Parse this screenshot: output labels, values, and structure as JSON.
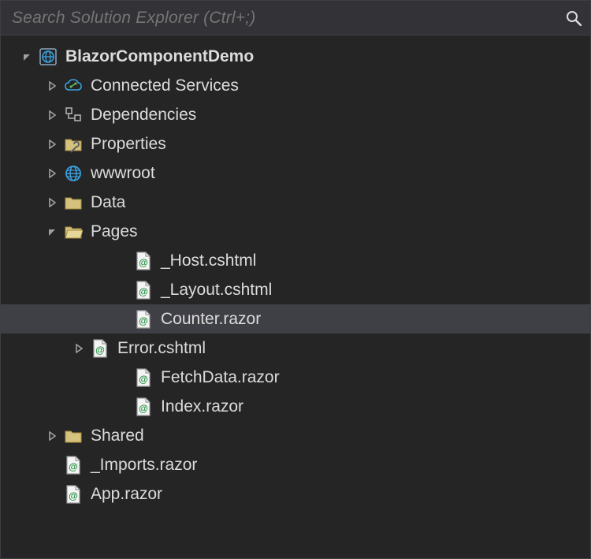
{
  "search": {
    "placeholder": "Search Solution Explorer (Ctrl+;)"
  },
  "project": {
    "name": "BlazorComponentDemo"
  },
  "nodes": {
    "connected_services": "Connected Services",
    "dependencies": "Dependencies",
    "properties": "Properties",
    "wwwroot": "wwwroot",
    "data": "Data",
    "pages": "Pages",
    "shared": "Shared",
    "imports": "_Imports.razor",
    "app": "App.razor"
  },
  "pages": {
    "host": "_Host.cshtml",
    "layout": "_Layout.cshtml",
    "counter": "Counter.razor",
    "error": "Error.cshtml",
    "fetch": "FetchData.razor",
    "index": "Index.razor"
  }
}
